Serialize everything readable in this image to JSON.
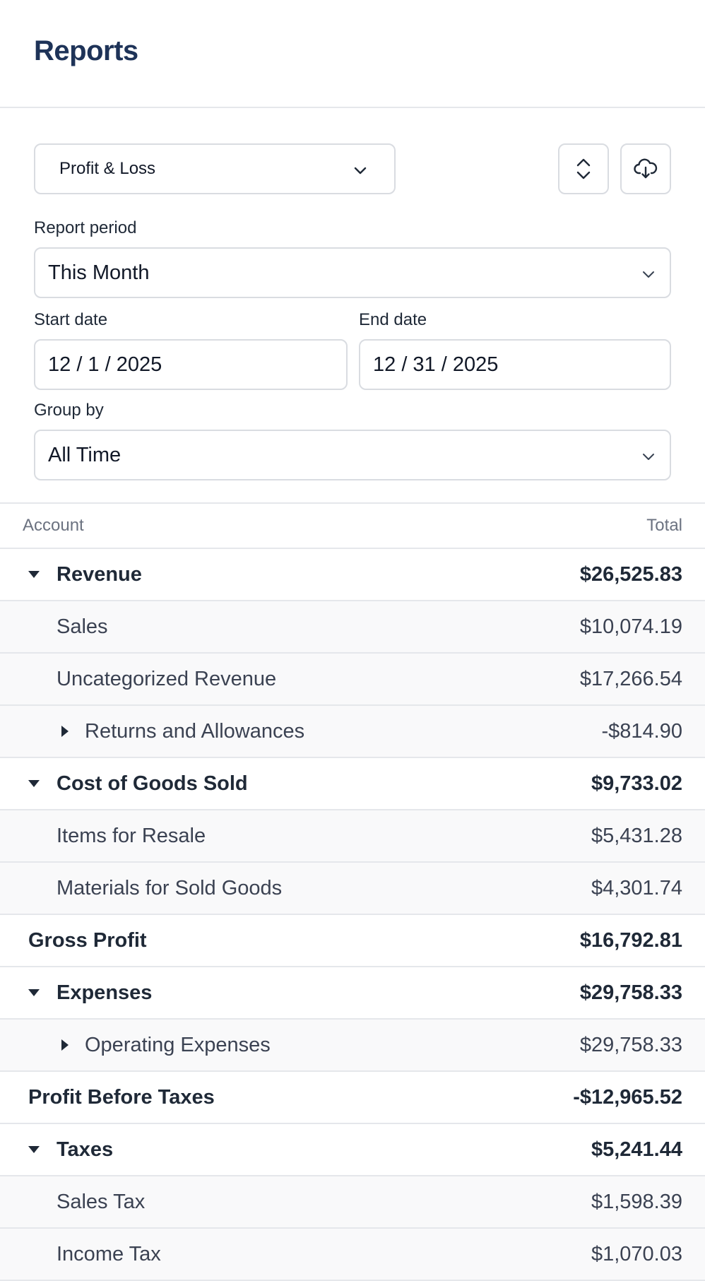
{
  "header": {
    "title": "Reports"
  },
  "toolbar": {
    "report_type": "Profit & Loss",
    "sort_icon": "chevron-up-down-icon",
    "download_icon": "cloud-download-icon"
  },
  "filters": {
    "period_label": "Report period",
    "period_value": "This Month",
    "start_label": "Start date",
    "start_value": "12 / 1 / 2025",
    "end_label": "End date",
    "end_value": "12 / 31 / 2025",
    "group_label": "Group by",
    "group_value": "All Time"
  },
  "table": {
    "col_account": "Account",
    "col_total": "Total",
    "rows": [
      {
        "label": "Revenue",
        "amount": "$26,525.83"
      },
      {
        "label": "Sales",
        "amount": "$10,074.19"
      },
      {
        "label": "Uncategorized Revenue",
        "amount": "$17,266.54"
      },
      {
        "label": "Returns and Allowances",
        "amount": "-$814.90"
      },
      {
        "label": "Cost of Goods Sold",
        "amount": "$9,733.02"
      },
      {
        "label": "Items for Resale",
        "amount": "$5,431.28"
      },
      {
        "label": "Materials for Sold Goods",
        "amount": "$4,301.74"
      },
      {
        "label": "Gross Profit",
        "amount": "$16,792.81"
      },
      {
        "label": "Expenses",
        "amount": "$29,758.33"
      },
      {
        "label": "Operating Expenses",
        "amount": "$29,758.33"
      },
      {
        "label": "Profit Before Taxes",
        "amount": "-$12,965.52"
      },
      {
        "label": "Taxes",
        "amount": "$5,241.44"
      },
      {
        "label": "Sales Tax",
        "amount": "$1,598.39"
      },
      {
        "label": "Income Tax",
        "amount": "$1,070.03"
      }
    ]
  },
  "colors": {
    "title": "#1e3358",
    "border": "#e5e7eb",
    "child_row_bg": "#f9f9fa"
  }
}
